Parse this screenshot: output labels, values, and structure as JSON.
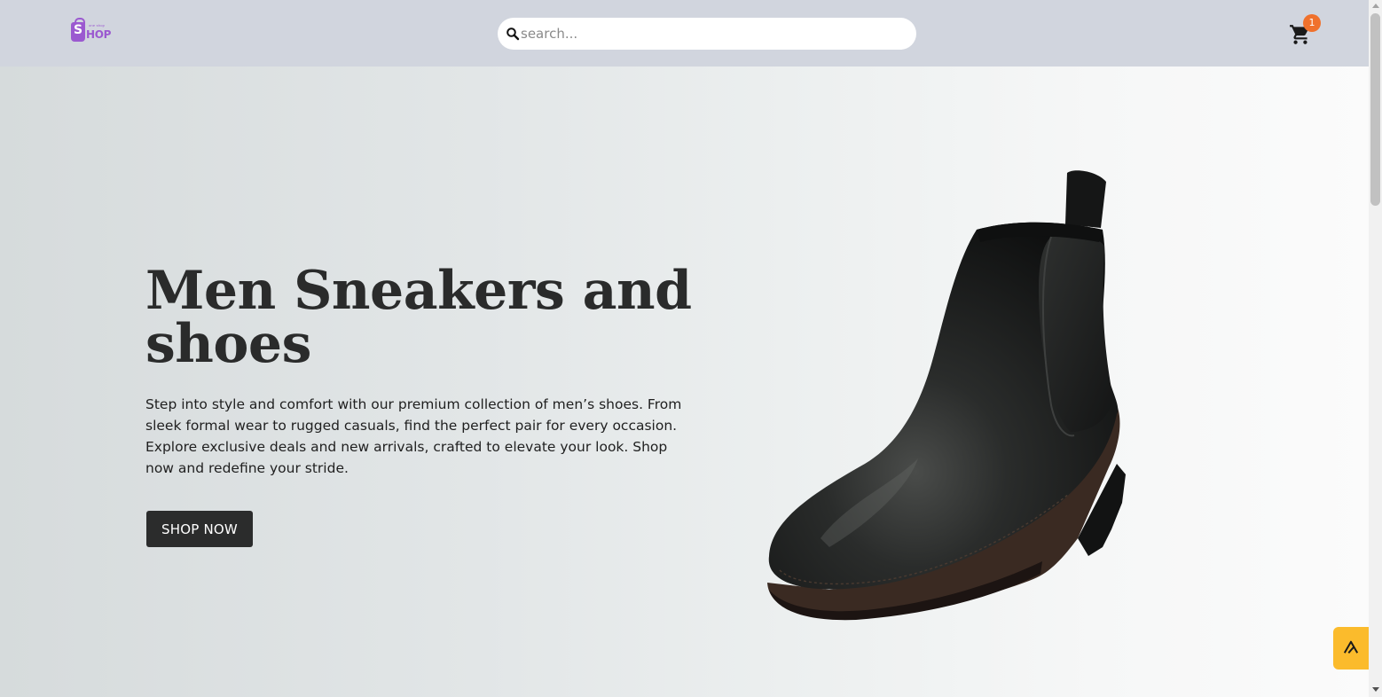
{
  "header": {
    "logo": {
      "initial": "S",
      "text": "HOP",
      "tag": "one shop"
    },
    "search": {
      "placeholder": "search...",
      "value": ""
    },
    "cart": {
      "count": "1",
      "icon": "cart-icon"
    }
  },
  "hero": {
    "title": "Men Sneakers and shoes",
    "description": "Step into style and comfort with our premium collection of men’s shoes. From sleek formal wear to rugged casuals, find the perfect pair for every occasion. Explore exclusive deals and new arrivals, crafted to elevate your look. Shop now and redefine your stride.",
    "cta_label": "SHOP NOW",
    "image_icon": "chelsea-boot-image"
  },
  "widget": {
    "icon": "assistant-logo-icon"
  },
  "colors": {
    "header_bg": "#d1d5de",
    "brand_purple": "#9b59d0",
    "badge_orange": "#f0712c",
    "button_dark": "#2b2c2c",
    "widget_yellow": "#fbbb2c"
  }
}
